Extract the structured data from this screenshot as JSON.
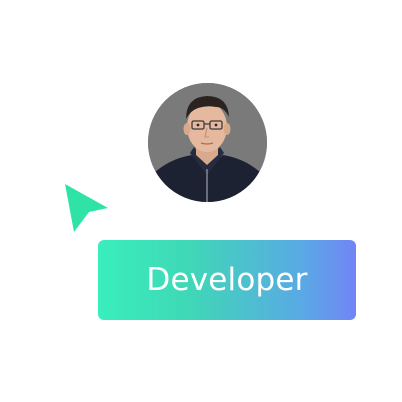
{
  "role_button": {
    "label": "Developer",
    "gradient_start": "#39eebc",
    "gradient_end": "#7284f5",
    "text_color": "#ffffff"
  },
  "cursor": {
    "icon": "pointer-arrow-icon",
    "color": "#2fe3a6"
  },
  "avatar": {
    "icon": "user-photo-avatar"
  }
}
